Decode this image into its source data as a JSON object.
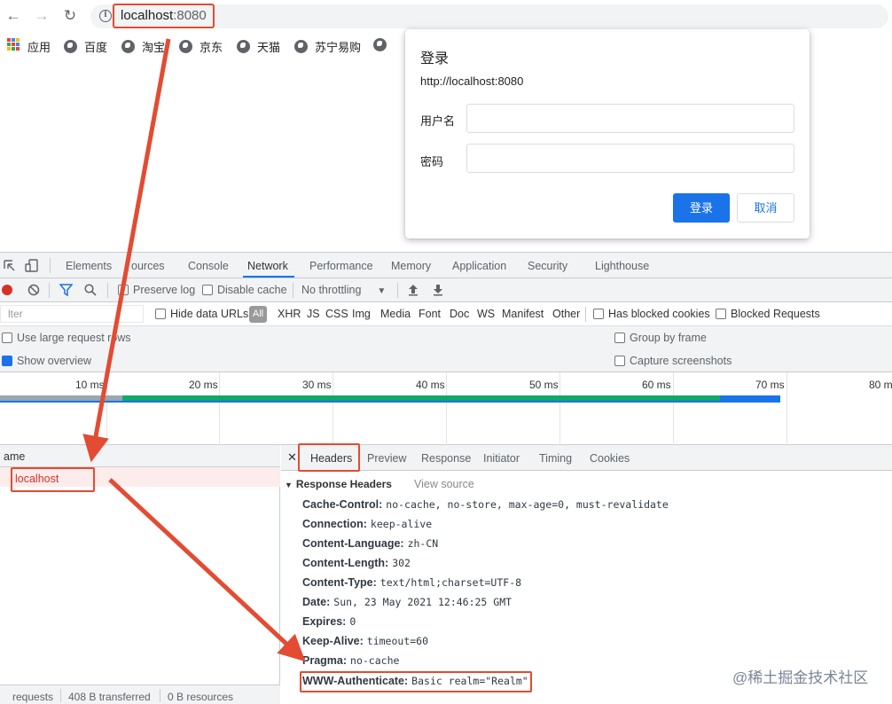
{
  "browser": {
    "url_host": "localhost",
    "url_port": ":8080",
    "bookmarks": [
      "应用",
      "百度",
      "淘宝",
      "京东",
      "天猫",
      "苏宁易购"
    ]
  },
  "dialog": {
    "title": "登录",
    "origin": "http://localhost:8080",
    "username_label": "用户名",
    "password_label": "密码",
    "username_value": "",
    "password_value": "",
    "login_button": "登录",
    "cancel_button": "取消",
    "accent_color": "#1a73e8"
  },
  "devtools": {
    "tabs": [
      "Elements",
      "Sources",
      "Console",
      "Network",
      "Performance",
      "Memory",
      "Application",
      "Security",
      "Lighthouse"
    ],
    "tab_sources_partial": "ources",
    "active_tab": "Network",
    "toolbar": {
      "preserve_log": "Preserve log",
      "disable_cache": "Disable cache",
      "throttling": "No throttling"
    },
    "filter": {
      "placeholder": "lter",
      "hide_data_urls": "Hide data URLs",
      "types": [
        "All",
        "XHR",
        "JS",
        "CSS",
        "Img",
        "Media",
        "Font",
        "Doc",
        "WS",
        "Manifest",
        "Other"
      ],
      "has_blocked_cookies": "Has blocked cookies",
      "blocked_requests": "Blocked Requests"
    },
    "options": {
      "large_rows": "Use large request rows",
      "show_overview": "Show overview",
      "group_by_frame": "Group by frame",
      "capture_screenshots": "Capture screenshots"
    },
    "timeline_ticks": [
      "10 ms",
      "20 ms",
      "30 ms",
      "40 ms",
      "50 ms",
      "60 ms",
      "70 ms",
      "80 ms"
    ],
    "name_header": "ame",
    "requests": [
      "localhost"
    ],
    "status": {
      "requests": "requests",
      "transferred": "408 B transferred",
      "resources": "0 B resources"
    },
    "detail_tabs": [
      "Headers",
      "Preview",
      "Response",
      "Initiator",
      "Timing",
      "Cookies"
    ],
    "section_title": "Response Headers",
    "view_source": "View source",
    "headers": [
      {
        "k": "Cache-Control:",
        "v": "no-cache, no-store, max-age=0, must-revalidate"
      },
      {
        "k": "Connection:",
        "v": "keep-alive"
      },
      {
        "k": "Content-Language:",
        "v": "zh-CN"
      },
      {
        "k": "Content-Length:",
        "v": "302"
      },
      {
        "k": "Content-Type:",
        "v": "text/html;charset=UTF-8"
      },
      {
        "k": "Date:",
        "v": "Sun, 23 May 2021 12:46:25 GMT"
      },
      {
        "k": "Expires:",
        "v": "0"
      },
      {
        "k": "Keep-Alive:",
        "v": "timeout=60"
      },
      {
        "k": "Pragma:",
        "v": "no-cache"
      },
      {
        "k": "WWW-Authenticate:",
        "v": "Basic realm=\"Realm\""
      }
    ]
  },
  "annotation_color": "#e34b32",
  "watermark": "@稀土掘金技术社区"
}
